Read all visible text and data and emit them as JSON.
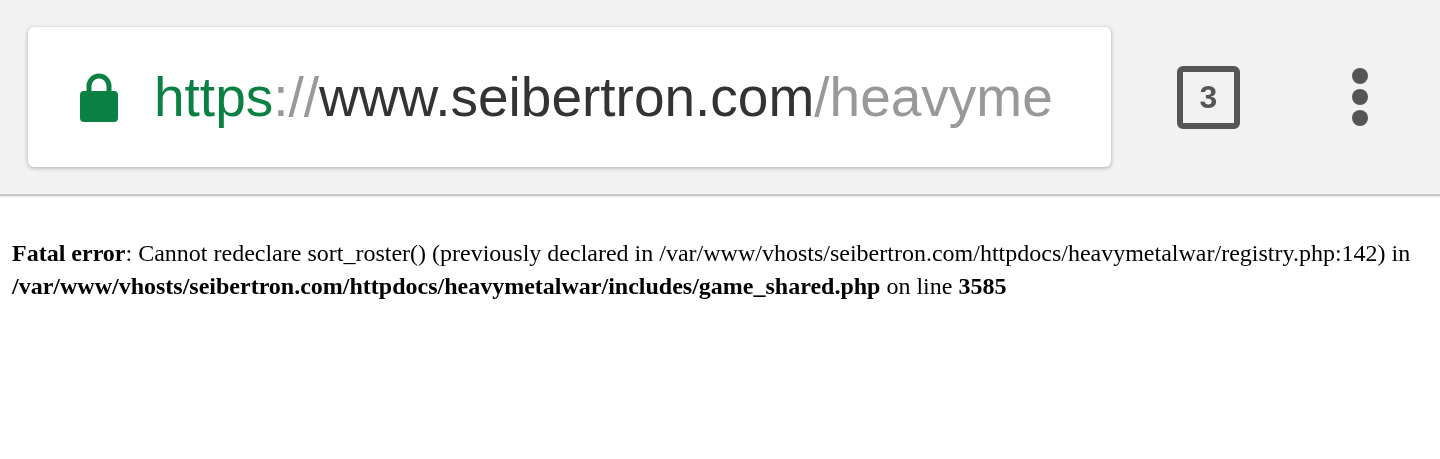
{
  "toolbar": {
    "secure": true,
    "url": {
      "scheme": "https",
      "separator": "://",
      "host": "www.seibertron.com",
      "path": "/heavyme"
    },
    "tab_count": "3"
  },
  "page": {
    "error": "**Fatal error**: Cannot redeclare sort_roster() (previously declared in /var/www/vhosts/seibertron.com/httpdocs/heavymetalwar/registry.php:142) in **/var/www/vhosts/seibertron.com/httpdocs/heavymetalwar/includes/game_shared.php** on line **3585**"
  }
}
